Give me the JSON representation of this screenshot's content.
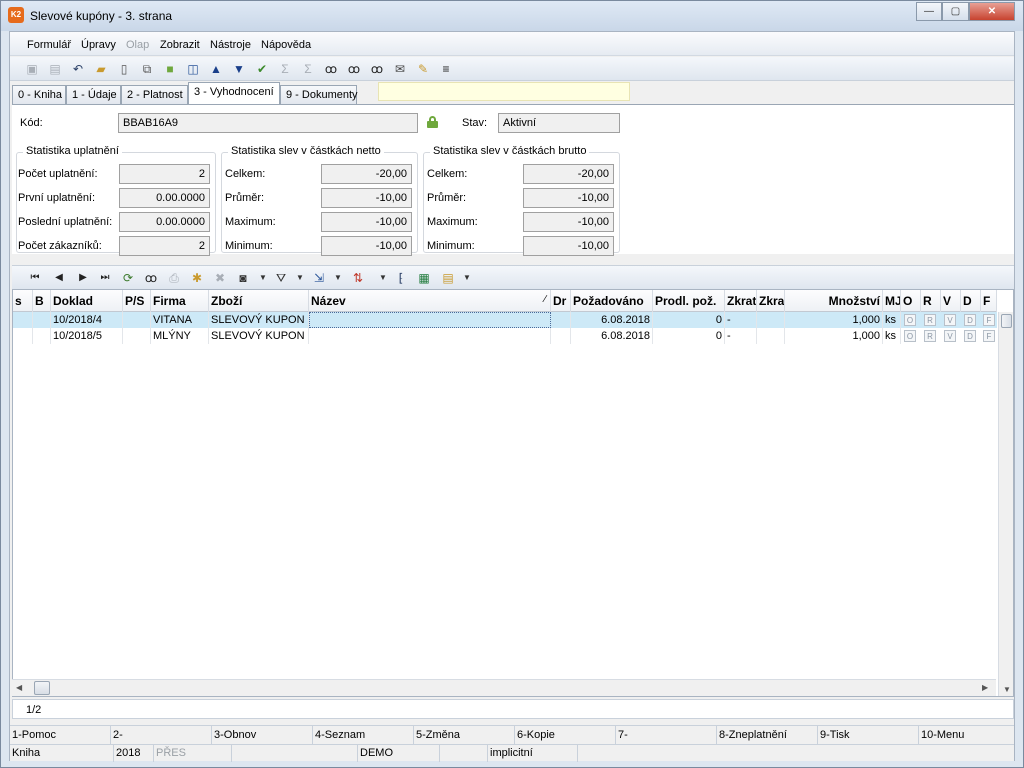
{
  "window": {
    "title": "Slevové kupóny - 3. strana",
    "minimize_glyph": "—",
    "maximize_glyph": "▢",
    "close_glyph": "✕"
  },
  "menu": [
    "Formulář",
    "Úpravy",
    "Olap",
    "Zobrazit",
    "Nástroje",
    "Nápověda"
  ],
  "tabs": [
    "0 - Kniha",
    "1 - Údaje",
    "2 - Platnost",
    "3 - Vyhodnocení",
    "9 - Dokumenty"
  ],
  "header": {
    "kod_label": "Kód:",
    "kod_value": "BBAB16A9",
    "stav_label": "Stav:",
    "stav_value": "Aktivní"
  },
  "stats_usage": {
    "title": "Statistika uplatnění",
    "rows": [
      {
        "label": "Počet uplatnění:",
        "value": "2"
      },
      {
        "label": "První uplatnění:",
        "value": "0.00.0000"
      },
      {
        "label": "Poslední uplatnění:",
        "value": "0.00.0000"
      },
      {
        "label": "Počet zákazníků:",
        "value": "2"
      }
    ]
  },
  "stats_netto": {
    "title": "Statistika slev v částkách netto",
    "rows": [
      {
        "label": "Celkem:",
        "value": "-20,00"
      },
      {
        "label": "Průměr:",
        "value": "-10,00"
      },
      {
        "label": "Maximum:",
        "value": "-10,00"
      },
      {
        "label": "Minimum:",
        "value": "-10,00"
      }
    ]
  },
  "stats_brutto": {
    "title": "Statistika slev v částkách brutto",
    "rows": [
      {
        "label": "Celkem:",
        "value": "-20,00"
      },
      {
        "label": "Průměr:",
        "value": "-10,00"
      },
      {
        "label": "Maximum:",
        "value": "-10,00"
      },
      {
        "label": "Minimum:",
        "value": "-10,00"
      }
    ]
  },
  "grid": {
    "columns": [
      "s",
      "B",
      "Doklad",
      "P/S",
      "Firma",
      "Zboží",
      "Název",
      "Dr",
      "Požadováno",
      "Prodl. pož.",
      "Zkrat",
      "Zkra",
      "Množství",
      "MJ",
      "O",
      "R",
      "V",
      "D",
      "F"
    ],
    "sort_glyph": "∕",
    "rows": [
      {
        "doklad": "10/2018/4",
        "firma": "VITANA",
        "zbozi": "SLEVOVÝ KUPON",
        "nazev": "",
        "pozadovano": "6.08.2018",
        "prodl": "0",
        "zkrat": "-",
        "mnozstvi": "1,000",
        "mj": "ks",
        "flags": [
          "O",
          "R",
          "V",
          "D",
          "F"
        ]
      },
      {
        "doklad": "10/2018/5",
        "firma": "MLÝNY",
        "zbozi": "SLEVOVÝ KUPON",
        "nazev": "",
        "pozadovano": "6.08.2018",
        "prodl": "0",
        "zkrat": "-",
        "mnozstvi": "1,000",
        "mj": "ks",
        "flags": [
          "O",
          "R",
          "V",
          "D",
          "F"
        ]
      }
    ]
  },
  "pager": "1/2",
  "fkeys": [
    "1-Pomoc",
    "2-",
    "3-Obnov",
    "4-Seznam",
    "5-Změna",
    "6-Kopie",
    "7-",
    "8-Zneplatnění",
    "9-Tisk",
    "10-Menu"
  ],
  "status": [
    "Kniha",
    "2018",
    "PŘES",
    "",
    "DEMO",
    "implicitní",
    ""
  ],
  "icons": {
    "main_toolbar": [
      "save-icon",
      "save-all-icon",
      "undo-icon",
      "open-folder-icon",
      "new-document-icon",
      "copy-icon",
      "lock-icon",
      "book-icon",
      "arrow-up-icon",
      "arrow-down-icon",
      "filter-check-icon",
      "sum-icon",
      "sum-filter-icon",
      "binoculars-icon",
      "find-next-icon",
      "find-replace-icon",
      "mail-icon",
      "edit-list-icon",
      "menu-lines-icon"
    ],
    "grid_toolbar": [
      "first-record-icon",
      "prev-record-icon",
      "next-record-icon",
      "last-record-icon",
      "refresh-icon",
      "binoculars-icon",
      "print-icon",
      "new-star-icon",
      "delete-icon",
      "camera-icon",
      "filter-icon",
      "export-icon",
      "sort-icon",
      "columns-icon",
      "excel-icon",
      "notes-icon"
    ]
  },
  "colors": {
    "selected_row": "#cde9f7",
    "hint_box": "#ffffe1",
    "lock_green": "#6fa83d"
  }
}
